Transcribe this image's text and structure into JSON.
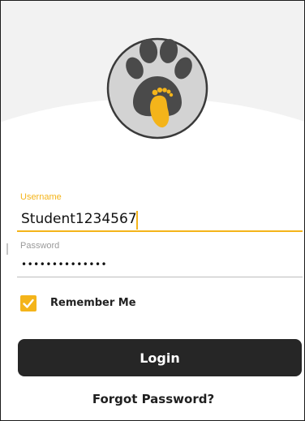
{
  "logo": {
    "icon": "paw-foot-icon",
    "colors": {
      "circle_fill": "#d3d3d3",
      "circle_stroke": "#3a3a3a",
      "paw": "#4a4a4a",
      "foot": "#f4b41a"
    }
  },
  "form": {
    "username": {
      "label": "Username",
      "value": "Student1234567"
    },
    "password": {
      "label": "Password",
      "masked_value": "••••••••••••••"
    },
    "remember_me": {
      "label": "Remember Me",
      "checked": true
    },
    "login_label": "Login",
    "forgot_password_label": "Forgot Password?"
  },
  "colors": {
    "accent": "#f4b41a",
    "button_bg": "#262626",
    "button_text": "#ffffff"
  }
}
